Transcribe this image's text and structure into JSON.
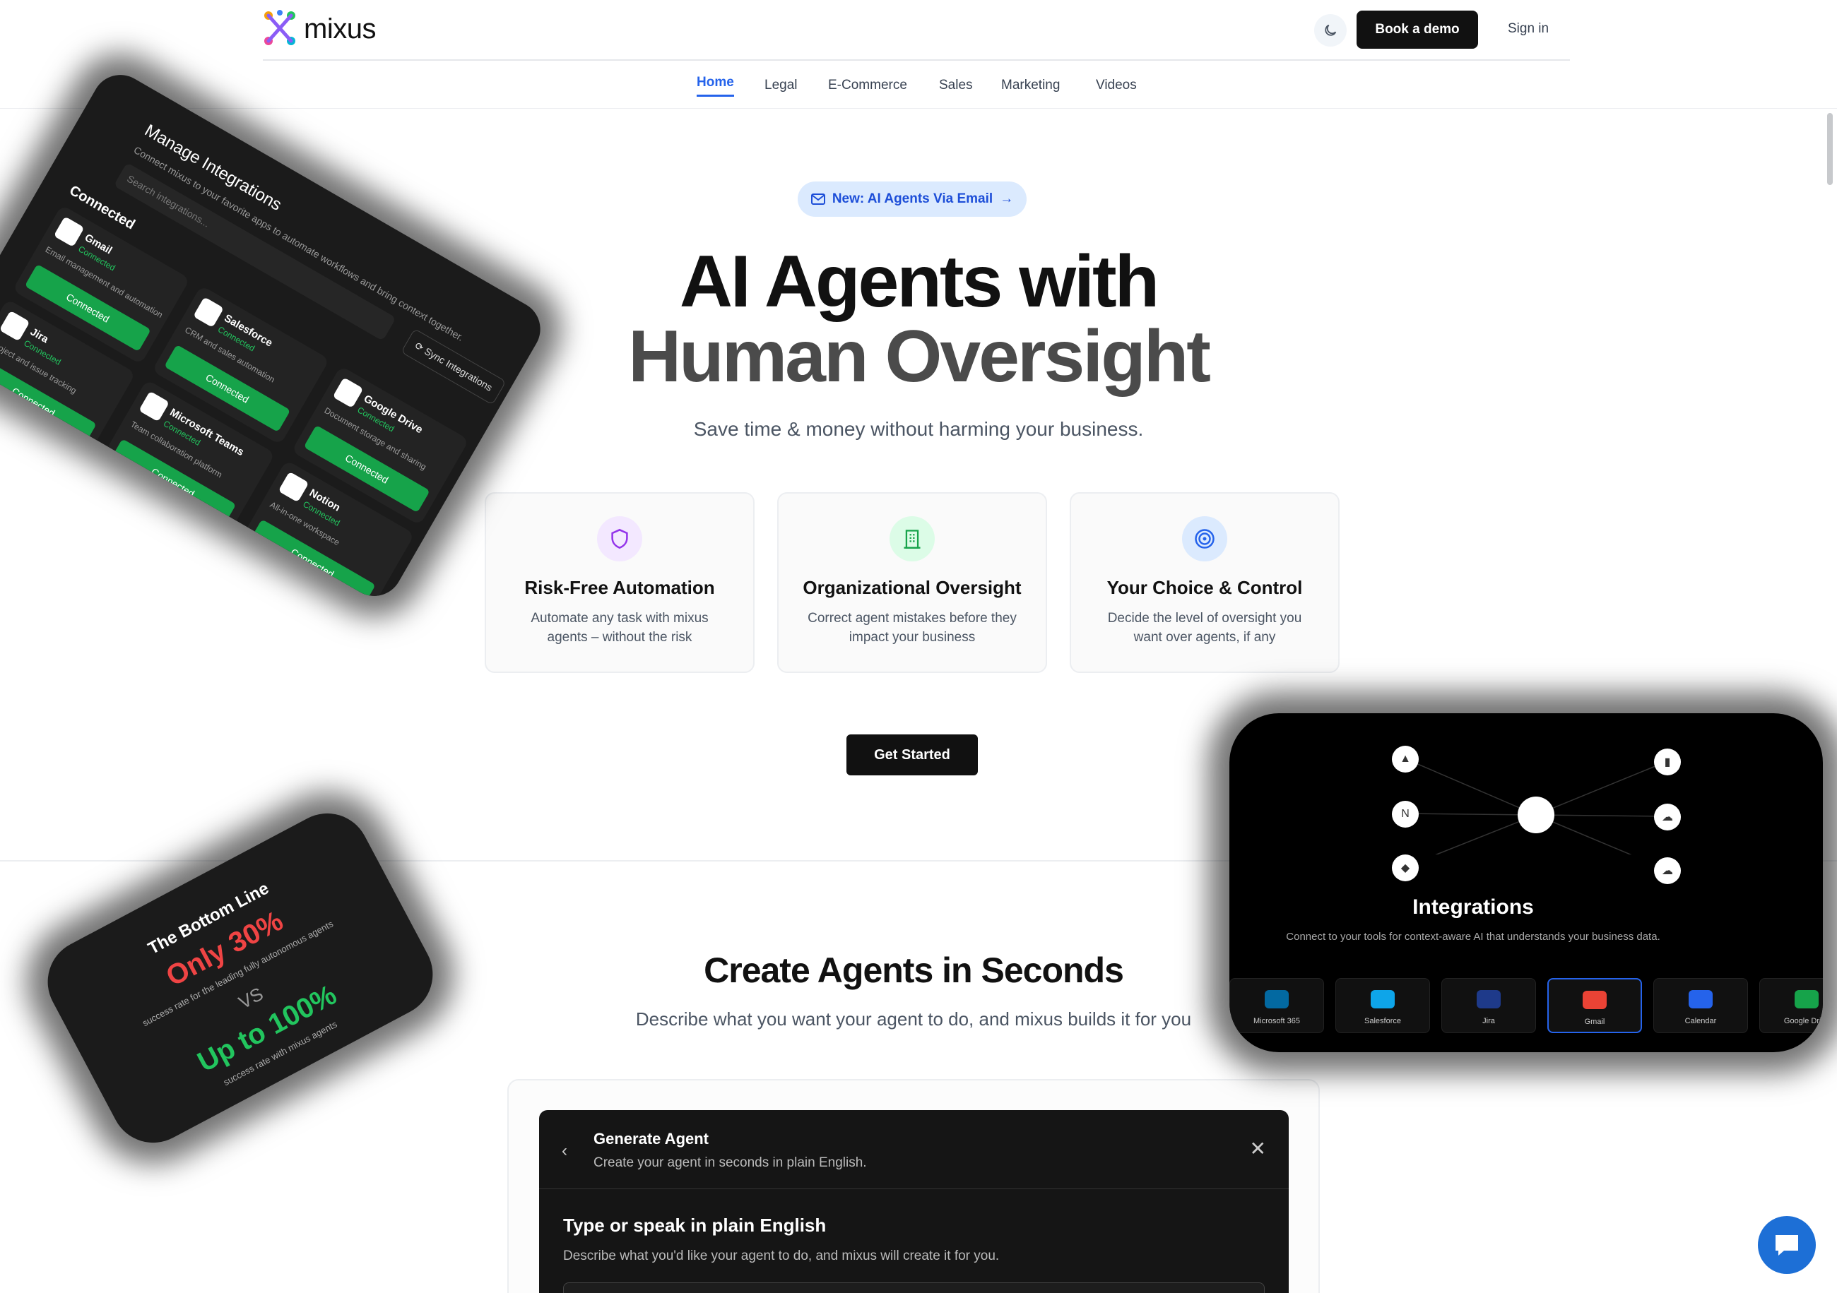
{
  "brand": {
    "name": "mixus"
  },
  "header": {
    "book_demo": "Book a demo",
    "sign_in": "Sign in",
    "theme_icon": "moon-icon"
  },
  "nav": {
    "items": [
      {
        "label": "Home",
        "active": true
      },
      {
        "label": "Legal"
      },
      {
        "label": "E-Commerce"
      },
      {
        "label": "Sales"
      },
      {
        "label": "Marketing"
      },
      {
        "label": "Videos"
      }
    ]
  },
  "hero": {
    "pill": "New: AI Agents Via Email",
    "title_line1": "AI Agents with",
    "title_line2": "Human Oversight",
    "subtitle": "Save time & money without harming your business.",
    "cta": "Get Started"
  },
  "features": [
    {
      "title": "Risk-Free Automation",
      "desc": "Automate any task with mixus agents – without the risk",
      "icon": "shield-icon",
      "color": "#9333ea",
      "bg": "#f3e8ff"
    },
    {
      "title": "Organizational Oversight",
      "desc": "Correct agent mistakes before they impact your business",
      "icon": "building-icon",
      "color": "#16a34a",
      "bg": "#dcfce7"
    },
    {
      "title": "Your Choice & Control",
      "desc": "Decide the level of oversight you want over agents, if any",
      "icon": "target-icon",
      "color": "#2563eb",
      "bg": "#dbeafe"
    }
  ],
  "create": {
    "title": "Create Agents in Seconds",
    "subtitle": "Describe what you want your agent to do, and mixus builds it for you"
  },
  "generate": {
    "title": "Generate Agent",
    "desc": "Create your agent in seconds in plain English.",
    "heading": "Type or speak in plain English",
    "prompt": "Describe what you'd like your agent to do, and mixus will create it for you."
  },
  "manage": {
    "title": "Manage Integrations",
    "desc": "Connect mixus to your favorite apps to automate workflows and bring context together.",
    "search_placeholder": "Search integrations...",
    "sync": "Sync Integrations",
    "section": "Connected",
    "tiles": [
      {
        "name": "Gmail",
        "status": "Connected",
        "desc": "Email management and automation",
        "button": "Connected"
      },
      {
        "name": "Salesforce",
        "status": "Connected",
        "desc": "CRM and sales automation",
        "button": "Connected"
      },
      {
        "name": "Google Drive",
        "status": "Connected",
        "desc": "Document storage and sharing",
        "button": "Connected"
      },
      {
        "name": "Jira",
        "status": "Connected",
        "desc": "Project and issue tracking",
        "button": "Connected"
      },
      {
        "name": "Microsoft Teams",
        "status": "Connected",
        "desc": "Team collaboration platform",
        "button": "Connected"
      },
      {
        "name": "Notion",
        "status": "Connected",
        "desc": "All-in-one workspace",
        "button": "Connected"
      }
    ]
  },
  "bottom_line": {
    "title": "The Bottom Line",
    "left": "Only 30%",
    "left_desc": "success rate for the leading fully autonomous agents",
    "vs": "VS",
    "right": "Up to 100%",
    "right_desc": "success rate with mixus agents"
  },
  "integrations": {
    "title": "Integrations",
    "desc": "Connect to your tools for context-aware AI that understands your business data.",
    "tiles": [
      "Microsoft 365",
      "Salesforce",
      "Jira",
      "Gmail",
      "Calendar",
      "Google Drive"
    ]
  }
}
